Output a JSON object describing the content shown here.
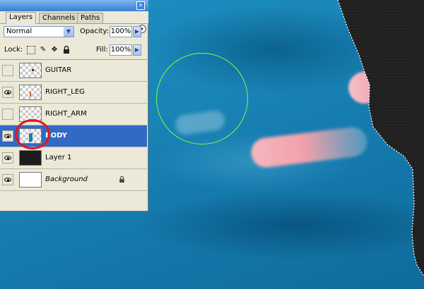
{
  "panel": {
    "tabs": [
      {
        "label": "Layers",
        "active": true
      },
      {
        "label": "Channels",
        "active": false
      },
      {
        "label": "Paths",
        "active": false
      }
    ],
    "close_glyph": "×",
    "menu_glyph": "▸",
    "blend_mode": "Normal",
    "opacity_label": "Opacity:",
    "opacity_value": "100%",
    "lock_label": "Lock:",
    "fill_label": "Fill:",
    "fill_value": "100%",
    "lock_icons": [
      "lock-transparent-icon",
      "lock-brush-icon",
      "lock-move-icon",
      "lock-all-icon"
    ],
    "layers": [
      {
        "name": "GUITAR",
        "visible": false,
        "selected": false,
        "thumb": "transparent"
      },
      {
        "name": "RIGHT_LEG",
        "visible": true,
        "selected": false,
        "thumb": "transparent"
      },
      {
        "name": "RIGHT_ARM",
        "visible": false,
        "selected": false,
        "thumb": "transparent"
      },
      {
        "name": "BODY",
        "visible": true,
        "selected": true,
        "thumb": "transparent"
      },
      {
        "name": "Layer 1",
        "visible": true,
        "selected": false,
        "thumb": "dark"
      },
      {
        "name": "Background",
        "visible": true,
        "selected": false,
        "thumb": "white",
        "locked": true
      }
    ]
  },
  "colors": {
    "selection": "#316ac5",
    "highlight_circle": "#e51717",
    "brush_cursor": "#7cff43",
    "canvas_blue": "#1a86b8"
  }
}
